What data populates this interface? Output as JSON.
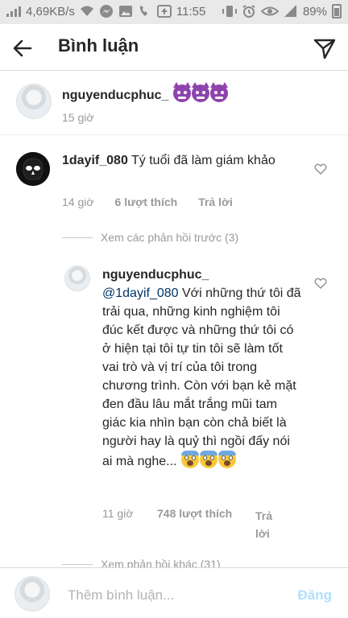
{
  "status_bar": {
    "speed": "4,69KB/s",
    "time": "11:55",
    "battery": "89%"
  },
  "header": {
    "title": "Bình luận"
  },
  "caption": {
    "username": "nguyenducphuc_",
    "time": "15 giờ"
  },
  "comment1": {
    "username": "1dayif_080",
    "text": "Tý tuổi đã làm giám khảo",
    "time": "14 giờ",
    "likes": "6 lượt thích",
    "reply": "Trả lời"
  },
  "view_previous": "Xem các phản hồi trước (3)",
  "reply1": {
    "username": "nguyenducphuc_",
    "mention": "@1dayif_080",
    "text": " Với những thứ tôi đã trải qua, những kinh nghiệm tôi đúc kết được và những thứ tôi có ở hiện tại tôi tự tin tôi sẽ làm tốt vai trò và vị trí của tôi trong chương trình. Còn với bạn kẻ mặt đen đầu lâu mắt trắng mũi tam giác kia nhìn bạn còn chả biết là người hay là quỷ thì ngồi đấy nói ai mà nghe...",
    "time": "11 giờ",
    "likes": "748 lượt thích",
    "reply": "Trả lời"
  },
  "view_more": "Xem phản hồi khác (31)",
  "composer": {
    "placeholder": "Thêm bình luận...",
    "post_label": "Đăng"
  },
  "colors": {
    "mention": "#003569",
    "post_disabled": "#b2dffc",
    "meta": "#999999"
  }
}
